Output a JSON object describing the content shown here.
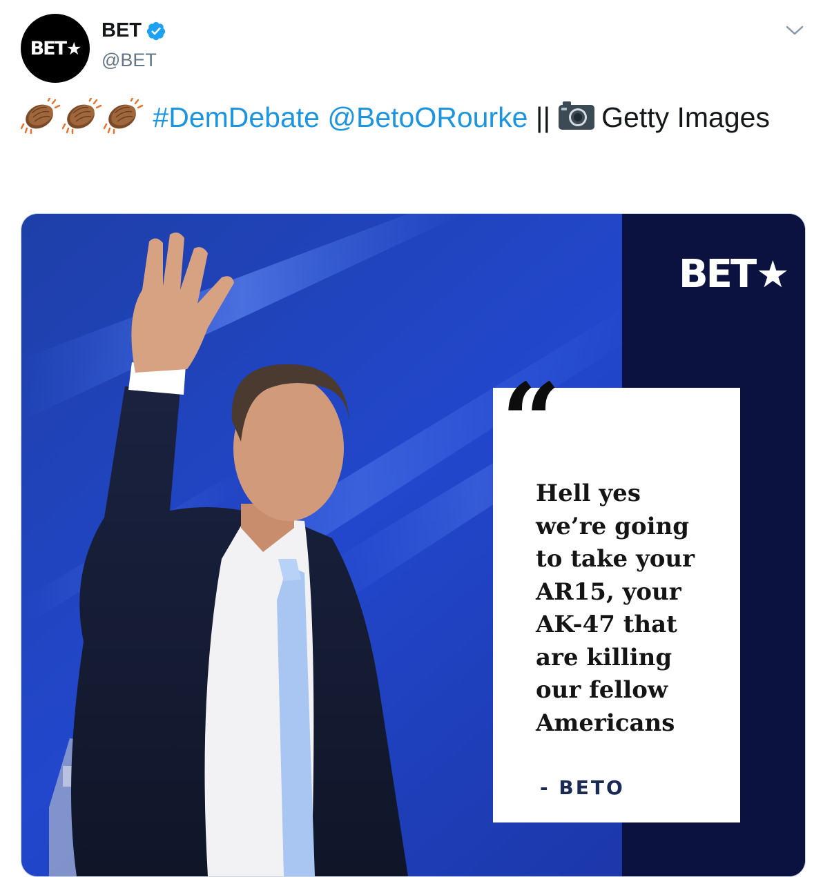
{
  "author": {
    "display_name": "BET",
    "handle": "@BET",
    "avatar_logo": "BET",
    "verified": true,
    "avatar_bg": "#000000"
  },
  "tweet": {
    "emoji": [
      "clapping-hands-medium-dark-skin",
      "clapping-hands-medium-dark-skin",
      "clapping-hands-medium-dark-skin"
    ],
    "hashtag": "#DemDebate",
    "mention": "@BetoORourke",
    "separator": "||",
    "camera_icon": "camera-icon",
    "credit": "Getty Images",
    "link_color": "#1b95e0"
  },
  "media": {
    "logo": "BET",
    "quote_mark": "“",
    "quote": "Hell yes\nwe’re going\nto take your\nAR15, your\nAK-47 that\nare killing\nour fellow\nAmericans",
    "attribution": "- BETO",
    "colors": {
      "background_blue": "#1d3fbf",
      "side_panel": "#0c1240",
      "card": "#ffffff"
    }
  },
  "icons": {
    "menu": "chevron-down-icon",
    "verified": "verified-badge-icon"
  }
}
